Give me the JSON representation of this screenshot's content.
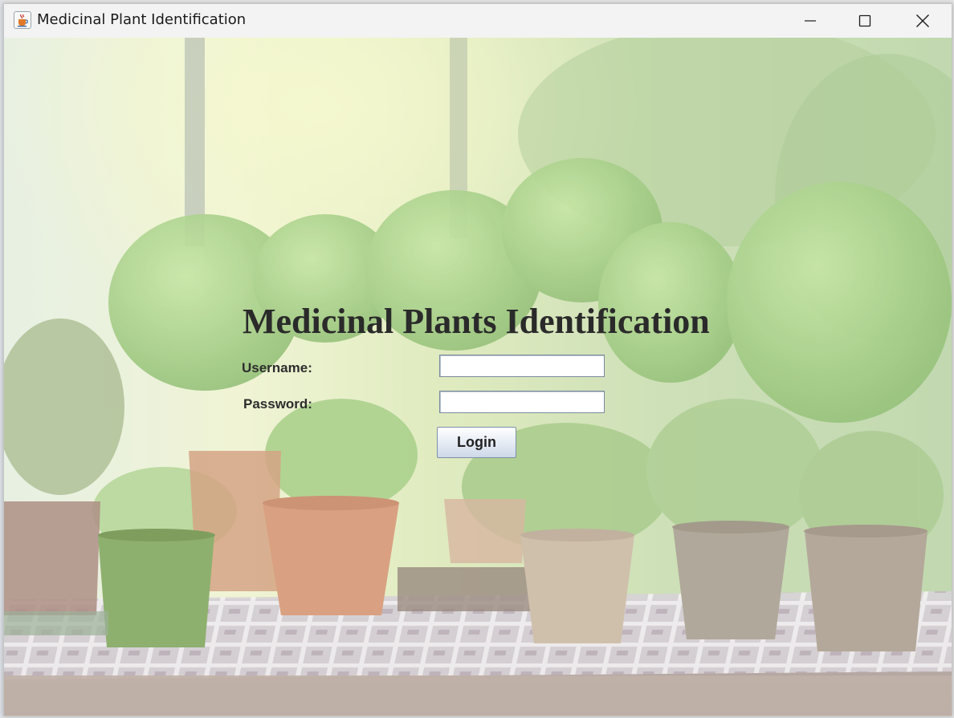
{
  "window": {
    "title": "Medicinal Plant Identification",
    "app_icon": "java-cup-icon",
    "controls": [
      "minimize-icon",
      "maximize-icon",
      "close-icon"
    ]
  },
  "login_form": {
    "heading": "Medicinal Plants Identification",
    "username_label": "Username:",
    "username_value": "",
    "password_label": "Password:",
    "password_value": "",
    "login_button": "Login"
  },
  "background": {
    "description_icon": "potted-herbs-photo",
    "colors": {
      "foliage": "#8dbf6a",
      "pot_terracotta": "#c8855b",
      "pot_green": "#6e9a44",
      "table": "#8a7a70"
    }
  }
}
